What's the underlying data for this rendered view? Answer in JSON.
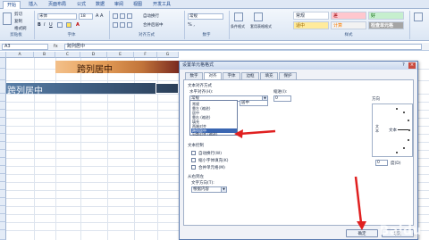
{
  "ribbon": {
    "tabs": [
      "开始",
      "插入",
      "页面布局",
      "公式",
      "数据",
      "审阅",
      "视图",
      "开发工具"
    ],
    "clipboard": {
      "cut": "剪切",
      "copy": "复制",
      "format_painter": "格式刷",
      "label": "剪贴板"
    },
    "font": {
      "name": "宋体",
      "size": "18",
      "label": "字体"
    },
    "alignment": {
      "wrap": "自动换行",
      "merge": "合并后居中",
      "label": "对齐方式"
    },
    "number": {
      "format": "常规",
      "label": "数字"
    },
    "styles": {
      "conditional": "条件格式",
      "table": "套用表格格式",
      "normal": "常规",
      "bad": "差",
      "good": "好",
      "neutral": "适中",
      "calc": "计算",
      "check": "检查单元格",
      "label": "样式"
    }
  },
  "formula_bar": {
    "name_box": "A3",
    "fx": "fx",
    "content": "跨列居中"
  },
  "sheet": {
    "columns": [
      "A",
      "B",
      "C",
      "D",
      "E",
      "F",
      "G"
    ],
    "title_text": "跨列居中",
    "row_text": "跨列居中"
  },
  "dialog": {
    "title": "设置单元格格式",
    "help": "?",
    "close": "×",
    "tabs": [
      "数字",
      "对齐",
      "字体",
      "边框",
      "填充",
      "保护"
    ],
    "active_tab": "对齐",
    "text_alignment": "文本对齐方式",
    "horizontal_label": "水平对齐(H):",
    "horizontal_value": "常规",
    "indent_label": "缩进(I):",
    "indent_value": "0",
    "vertical_label": "垂直对齐(V):",
    "vertical_value": "居中",
    "horizontal_options": [
      "常规",
      "靠左 (缩进)",
      "居中",
      "靠右 (缩进)",
      "填充",
      "两端对齐",
      "跨列居中",
      "分散对齐 (缩进)"
    ],
    "selected_option": "跨列居中",
    "text_control": "文本控制",
    "wrap": "自动换行(W)",
    "shrink": "缩小字体填充(K)",
    "merge": "合并单元格(M)",
    "rtl": "从右到左",
    "direction_label": "文字方向(T):",
    "direction_value": "根据内容",
    "orientation": "方向",
    "orientation_text": "文本",
    "orientation_vertical": "文本",
    "degrees_value": "0",
    "degrees_label": "度(D)",
    "ok": "确定",
    "cancel": "取消"
  },
  "watermark": {
    "brand": "Baidu",
    "sub": "经验"
  },
  "colors": {
    "title_bg": "#c97f3f",
    "title_dark": "#7a2a20",
    "row_bg": "#3f5f83",
    "row_dark": "#2b3f58",
    "arrow": "#e02020"
  }
}
